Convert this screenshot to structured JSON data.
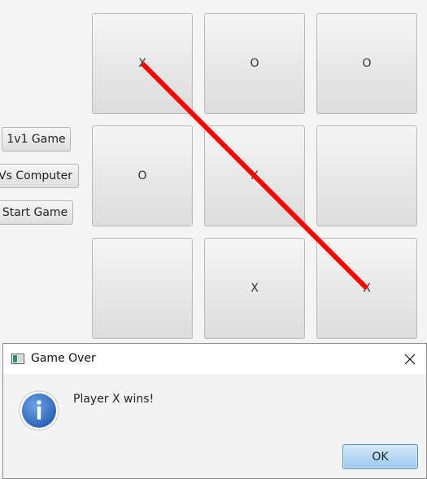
{
  "sidebar": {
    "one_v_one_label": "1v1 Game",
    "vs_computer_label": "Vs Computer",
    "start_label": "Start Game"
  },
  "board": {
    "cells": [
      "X",
      "O",
      "O",
      "O",
      "X",
      "",
      "",
      "X",
      "X"
    ],
    "winning_line": [
      0,
      4,
      8
    ],
    "winning_line_color": "#ff0000"
  },
  "dialog": {
    "title": "Game Over",
    "message": "Player X wins!",
    "ok_label": "OK",
    "icon": "info-icon",
    "accent_color": "#3a74c9"
  }
}
